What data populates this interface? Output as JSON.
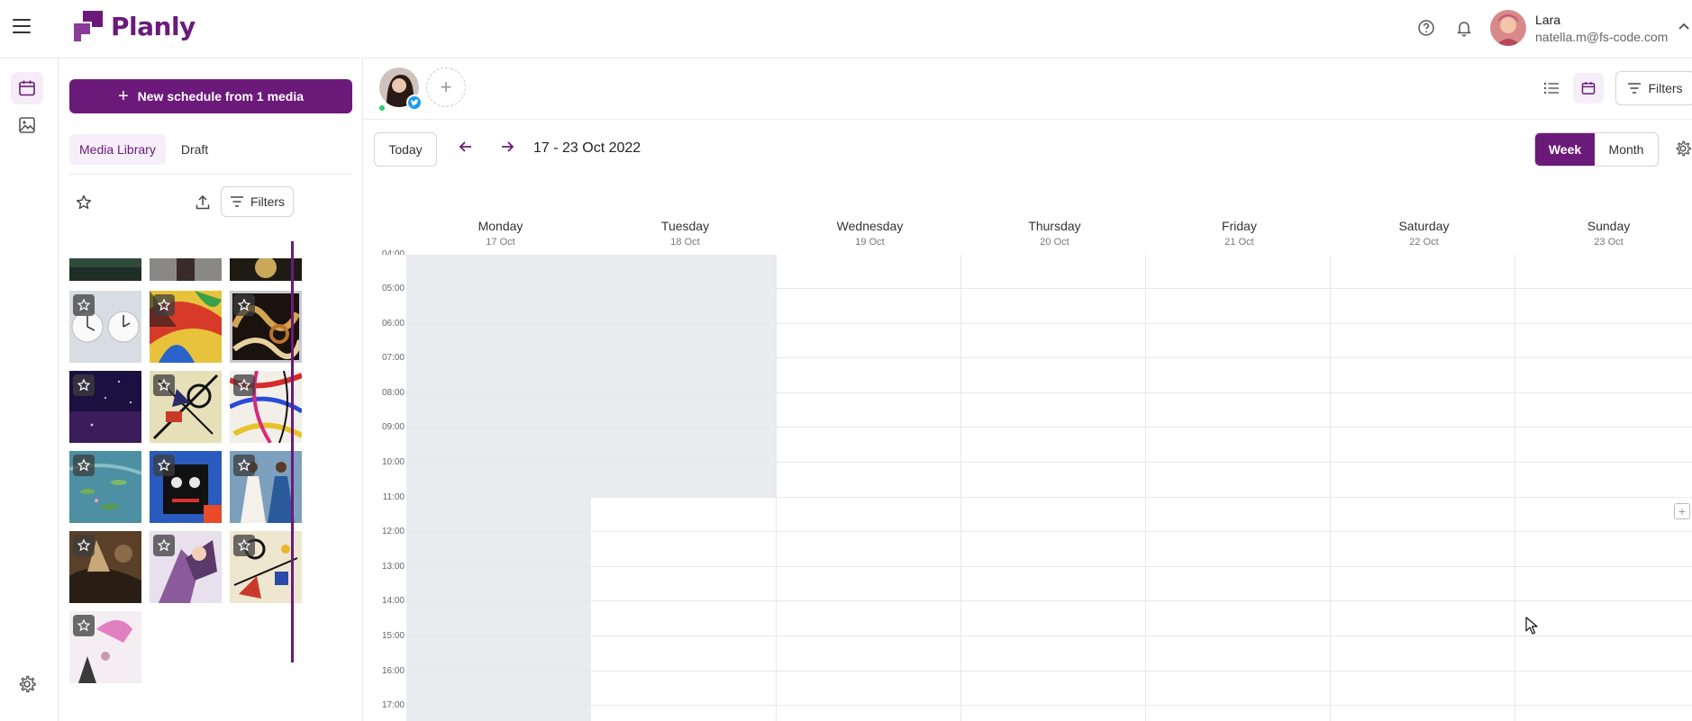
{
  "app": {
    "brand": "Planly"
  },
  "header": {
    "menu_icon": "hamburger-icon",
    "help_icon": "help-circle-icon",
    "bell_icon": "bell-icon",
    "user": {
      "name": "Lara",
      "email": "natella.m@fs-code.com"
    }
  },
  "rail": {
    "items": [
      "calendar-icon",
      "image-icon"
    ],
    "bottom": "gear-icon"
  },
  "media": {
    "new_button": "New schedule from 1 media",
    "tabs": [
      {
        "label": "Media Library",
        "active": true
      },
      {
        "label": "Draft",
        "active": false
      }
    ],
    "filters_label": "Filters"
  },
  "calendar": {
    "today_label": "Today",
    "range": "17 - 23 Oct 2022",
    "filters_label": "Filters",
    "views": [
      {
        "label": "Week",
        "active": true
      },
      {
        "label": "Month",
        "active": false
      }
    ],
    "days": [
      {
        "name": "Monday",
        "date": "17 Oct"
      },
      {
        "name": "Tuesday",
        "date": "18 Oct"
      },
      {
        "name": "Wednesday",
        "date": "19 Oct"
      },
      {
        "name": "Thursday",
        "date": "20 Oct"
      },
      {
        "name": "Friday",
        "date": "21 Oct"
      },
      {
        "name": "Saturday",
        "date": "22 Oct"
      },
      {
        "name": "Sunday",
        "date": "23 Oct"
      }
    ],
    "hours": [
      "04:00",
      "05:00",
      "06:00",
      "07:00",
      "08:00",
      "09:00",
      "10:00",
      "11:00",
      "12:00",
      "13:00",
      "14:00",
      "15:00",
      "16:00",
      "17:00"
    ]
  },
  "colors": {
    "brand": "#6b1a7a",
    "past": "#eaebef",
    "twitter": "#1d9bf0"
  }
}
